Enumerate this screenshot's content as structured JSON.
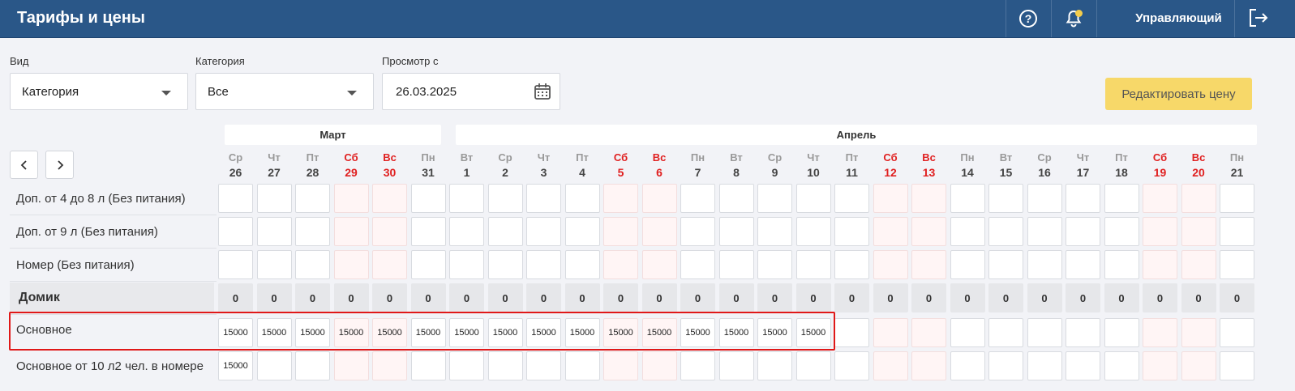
{
  "header": {
    "title": "Тарифы и цены",
    "user": "Управляющий",
    "icons": [
      "help-icon",
      "bell-icon",
      "logout-icon"
    ]
  },
  "filters": {
    "view": {
      "label": "Вид",
      "value": "Категория"
    },
    "category": {
      "label": "Категория",
      "value": "Все"
    },
    "date": {
      "label": "Просмотр с",
      "value": "26.03.2025"
    }
  },
  "edit_button": "Редактировать цену",
  "months": [
    "Март",
    "Апрель"
  ],
  "days": [
    {
      "dow": "Ср",
      "num": "26",
      "weekend": false
    },
    {
      "dow": "Чт",
      "num": "27",
      "weekend": false
    },
    {
      "dow": "Пт",
      "num": "28",
      "weekend": false
    },
    {
      "dow": "Сб",
      "num": "29",
      "weekend": true
    },
    {
      "dow": "Вс",
      "num": "30",
      "weekend": true
    },
    {
      "dow": "Пн",
      "num": "31",
      "weekend": false
    },
    {
      "dow": "Вт",
      "num": "1",
      "weekend": false
    },
    {
      "dow": "Ср",
      "num": "2",
      "weekend": false
    },
    {
      "dow": "Чт",
      "num": "3",
      "weekend": false
    },
    {
      "dow": "Пт",
      "num": "4",
      "weekend": false
    },
    {
      "dow": "Сб",
      "num": "5",
      "weekend": true
    },
    {
      "dow": "Вс",
      "num": "6",
      "weekend": true
    },
    {
      "dow": "Пн",
      "num": "7",
      "weekend": false
    },
    {
      "dow": "Вт",
      "num": "8",
      "weekend": false
    },
    {
      "dow": "Ср",
      "num": "9",
      "weekend": false
    },
    {
      "dow": "Чт",
      "num": "10",
      "weekend": false
    },
    {
      "dow": "Пт",
      "num": "11",
      "weekend": false
    },
    {
      "dow": "Сб",
      "num": "12",
      "weekend": true
    },
    {
      "dow": "Вс",
      "num": "13",
      "weekend": true
    },
    {
      "dow": "Пн",
      "num": "14",
      "weekend": false
    },
    {
      "dow": "Вт",
      "num": "15",
      "weekend": false
    },
    {
      "dow": "Ср",
      "num": "16",
      "weekend": false
    },
    {
      "dow": "Чт",
      "num": "17",
      "weekend": false
    },
    {
      "dow": "Пт",
      "num": "18",
      "weekend": false
    },
    {
      "dow": "Сб",
      "num": "19",
      "weekend": true
    },
    {
      "dow": "Вс",
      "num": "20",
      "weekend": true
    },
    {
      "dow": "Пн",
      "num": "21",
      "weekend": false
    }
  ],
  "rows": [
    {
      "label": "Доп. от 4 до 8 л (Без питания)",
      "kind": "rate",
      "values": []
    },
    {
      "label": "Доп. от 9 л (Без питания)",
      "kind": "rate",
      "values": []
    },
    {
      "label": "Номер (Без питания)",
      "kind": "rate",
      "values": []
    },
    {
      "label": "Домик",
      "kind": "total",
      "values": [
        "0",
        "0",
        "0",
        "0",
        "0",
        "0",
        "0",
        "0",
        "0",
        "0",
        "0",
        "0",
        "0",
        "0",
        "0",
        "0",
        "0",
        "0",
        "0",
        "0",
        "0",
        "0",
        "0",
        "0",
        "0",
        "0",
        "0"
      ]
    },
    {
      "label": "Основное",
      "kind": "rate",
      "values": [
        "15000",
        "15000",
        "15000",
        "15000",
        "15000",
        "15000",
        "15000",
        "15000",
        "15000",
        "15000",
        "15000",
        "15000",
        "15000",
        "15000",
        "15000",
        "15000"
      ]
    },
    {
      "label": "Основное от 10 л2 чел. в номере",
      "kind": "rate",
      "values": [
        "15000"
      ]
    }
  ],
  "colors": {
    "header": "#2a5788",
    "accent_button": "#f7d869",
    "weekend": "#e02020",
    "highlight": "#e01818"
  }
}
